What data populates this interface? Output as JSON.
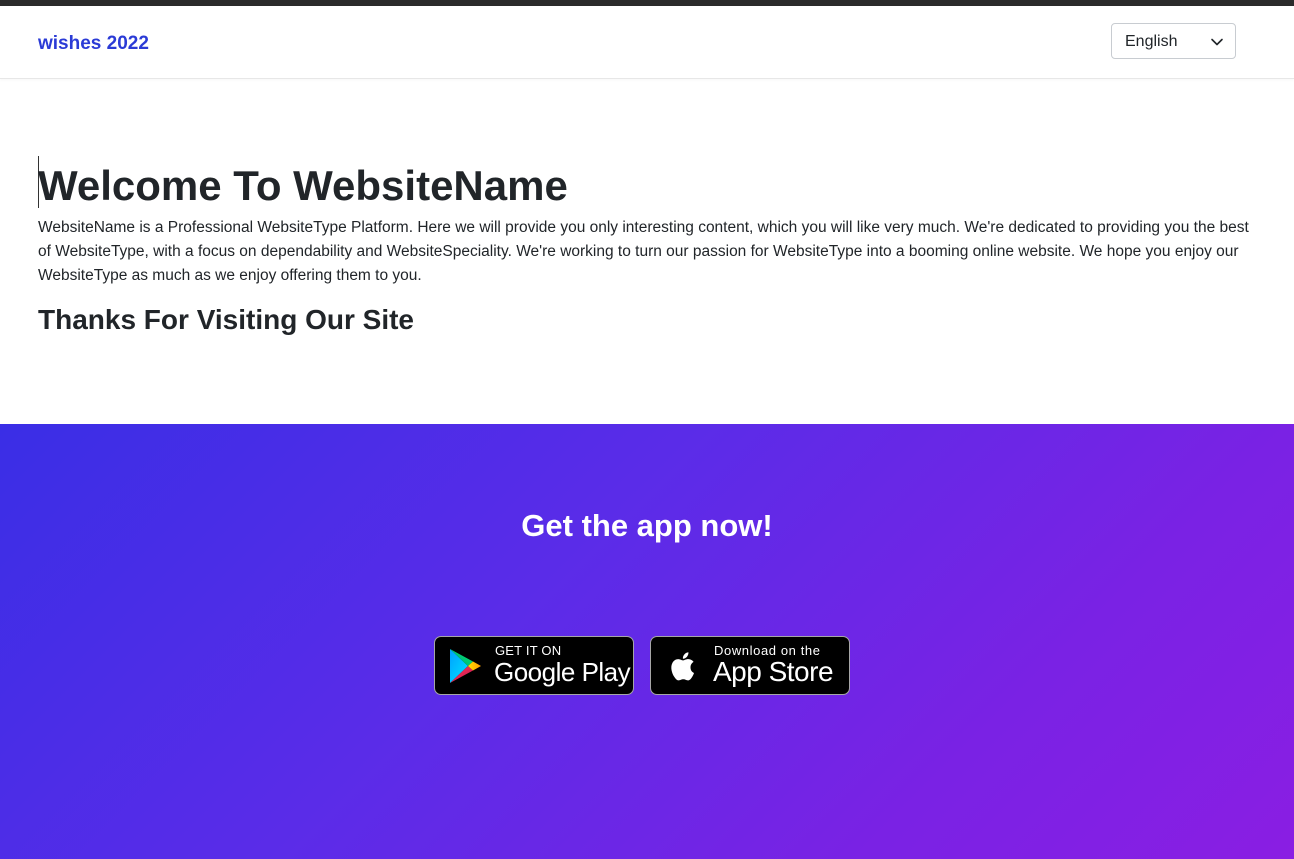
{
  "navbar": {
    "brand": "wishes 2022",
    "language": {
      "selected": "English"
    }
  },
  "main": {
    "heading": "Welcome To WebsiteName",
    "paragraph": "WebsiteName is a Professional WebsiteType Platform. Here we will provide you only interesting content, which you will like very much. We're dedicated to providing you the best of WebsiteType, with a focus on dependability and WebsiteSpeciality. We're working to turn our passion for WebsiteType into a booming online website. We hope you enjoy our WebsiteType as much as we enjoy offering them to you.",
    "subheading": "Thanks For Visiting Our Site"
  },
  "app_section": {
    "title": "Get the app now!",
    "google_play": {
      "small": "GET IT ON",
      "big": "Google Play",
      "icon": "google-play-icon"
    },
    "app_store": {
      "small": "Download on the",
      "big": "App Store",
      "icon": "apple-icon"
    }
  },
  "colors": {
    "brand": "#2b3bd6",
    "gradient_start": "#3a2ee6",
    "gradient_end": "#8a1ee3"
  }
}
